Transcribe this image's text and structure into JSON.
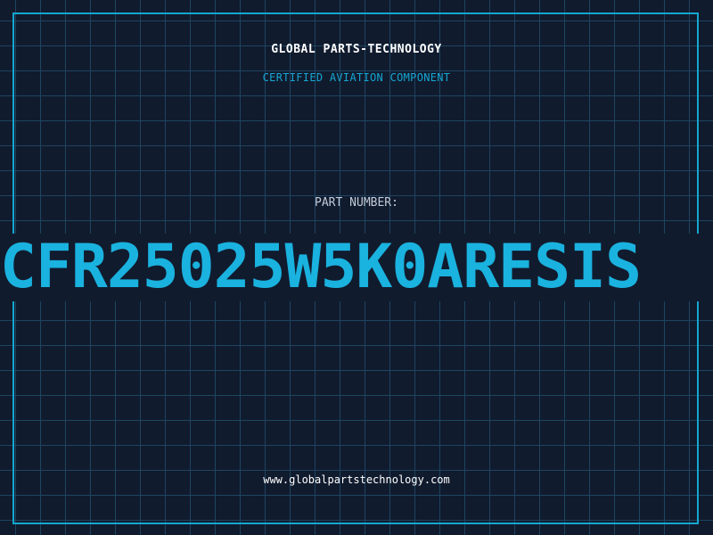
{
  "header": {
    "company": "GLOBAL PARTS-TECHNOLOGY",
    "subtitle": "CERTIFIED AVIATION COMPONENT"
  },
  "part": {
    "label": "PART NUMBER:",
    "number": "CFR25025W5K0ARESIS"
  },
  "footer": {
    "website": "www.globalpartstechnology.com"
  },
  "colors": {
    "background": "#111b2e",
    "grid": "#1e4460",
    "accent": "#1ab2df",
    "text": "#ffffff"
  }
}
